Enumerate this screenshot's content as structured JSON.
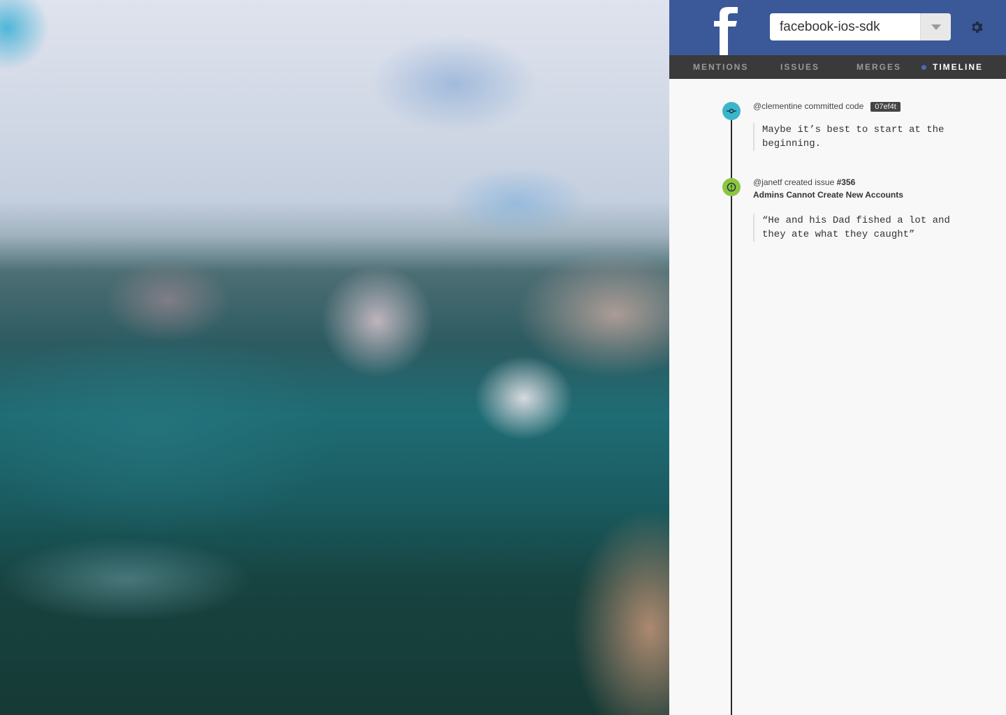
{
  "brand": {
    "logo_letter": "f",
    "header_color": "#3b5998"
  },
  "repo_selector": {
    "value": "facebook-ios-sdk",
    "caret_icon": "chevron-down-icon"
  },
  "settings": {
    "icon": "gear-icon"
  },
  "tabs": [
    {
      "label": "MENTIONS",
      "active": false
    },
    {
      "label": "ISSUES",
      "active": false
    },
    {
      "label": "MERGES",
      "active": false
    },
    {
      "label": "TIMELINE",
      "active": true
    }
  ],
  "timeline": {
    "events": [
      {
        "type": "commit",
        "icon": "commit-icon",
        "color": "#3ab5c9",
        "text": "@clementine committed code",
        "hash": "07ef4t",
        "quote": "Maybe it’s best to start at the beginning."
      },
      {
        "type": "issue",
        "icon": "alert-icon",
        "color": "#8cc63f",
        "text": "@janetf created issue",
        "issue_number": "#356",
        "title": "Admins Cannot Create New Accounts",
        "quote": "“He and his Dad fished a lot and they ate what they caught”"
      }
    ]
  }
}
